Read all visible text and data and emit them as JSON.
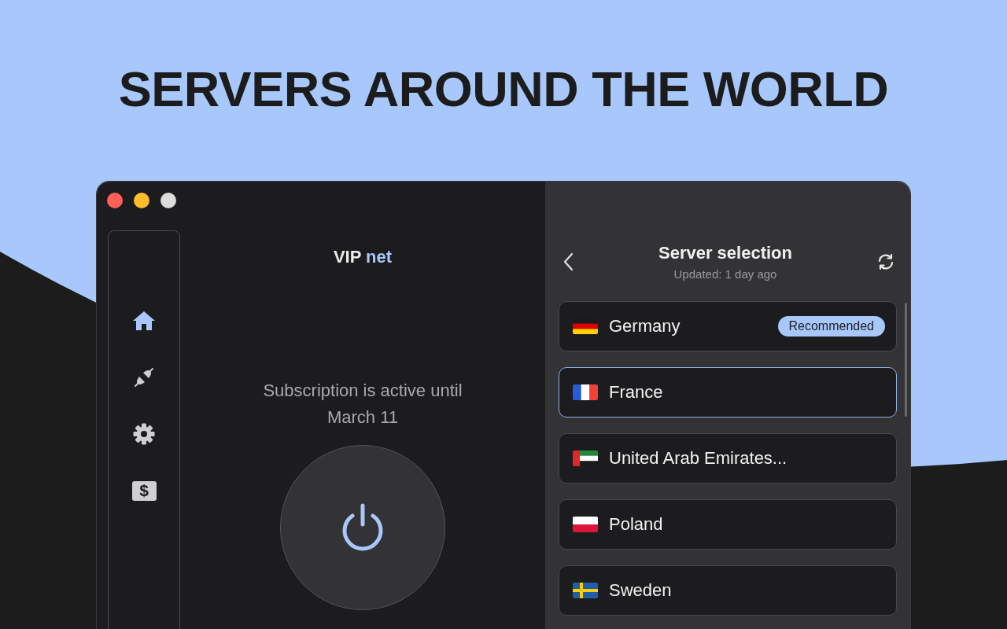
{
  "headline": "SERVERS AROUND THE WORLD",
  "sidebar": {
    "items": [
      {
        "kind": "home",
        "selected": true
      },
      {
        "kind": "connection",
        "selected": false
      },
      {
        "kind": "settings",
        "selected": false
      },
      {
        "kind": "billing",
        "glyph": "$",
        "selected": false
      }
    ]
  },
  "main": {
    "brand": "VIP",
    "brand_accent": "net",
    "subscription": "Subscription is active until March 11"
  },
  "server_panel": {
    "title": "Server selection",
    "subtitle": "Updated: 1 day ago"
  },
  "servers": [
    {
      "name": "Germany",
      "kind": "de",
      "badge": "Recommended",
      "selected": false
    },
    {
      "name": "France",
      "kind": "fr",
      "selected": true
    },
    {
      "name": "United Arab Emirates...",
      "kind": "ae",
      "selected": false
    },
    {
      "name": "Poland",
      "kind": "pl",
      "selected": false
    },
    {
      "name": "Sweden",
      "kind": "se",
      "selected": false
    }
  ]
}
